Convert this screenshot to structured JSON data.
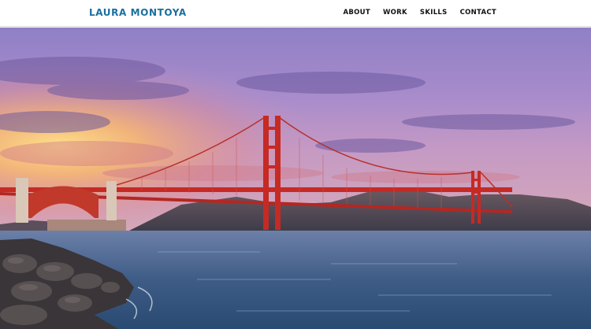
{
  "header": {
    "brand": "LAURA MONTOYA",
    "nav": [
      {
        "label": "ABOUT"
      },
      {
        "label": "WORK"
      },
      {
        "label": "SKILLS"
      },
      {
        "label": "CONTACT"
      }
    ]
  },
  "hero": {
    "image": "golden-gate-bridge-sunset-photo"
  },
  "colors": {
    "brand": "#1a6fa0",
    "nav_text": "#111111",
    "bridge": "#c62a24",
    "sky_top": "#8e7fc4",
    "water": "#3a5a84"
  }
}
